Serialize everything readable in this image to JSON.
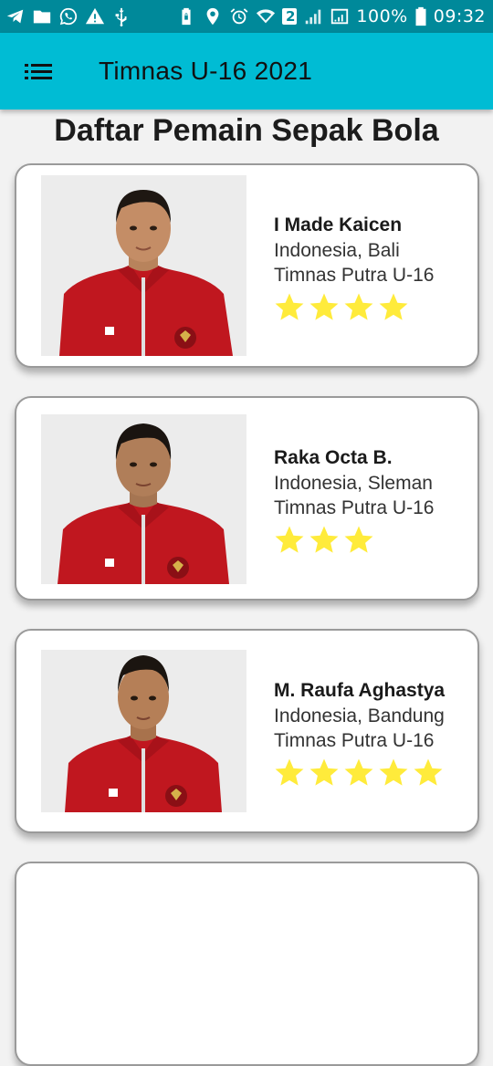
{
  "status_bar": {
    "battery": "100%",
    "time": "09:32",
    "sim_badge": "2",
    "left_icons": [
      "telegram-icon",
      "folder-icon",
      "whatsapp-icon",
      "warning-icon",
      "usb-icon"
    ],
    "right_icons": [
      "lock-battery-icon",
      "location-icon",
      "alarm-icon",
      "wifi-icon",
      "signal-icon",
      "signal-box-icon",
      "battery-icon"
    ]
  },
  "app_bar": {
    "title": "Timnas U-16 2021",
    "background": "#00bcd4",
    "menu_icon": "menu-icon"
  },
  "page": {
    "heading": "Daftar Pemain Sepak Bola"
  },
  "players": [
    {
      "name": "I Made Kaicen",
      "origin": "Indonesia, Bali",
      "team": "Timnas Putra U-16",
      "stars": 4
    },
    {
      "name": "Raka Octa B.",
      "origin": "Indonesia, Sleman",
      "team": "Timnas Putra U-16",
      "stars": 3
    },
    {
      "name": "M. Raufa Aghastya",
      "origin": "Indonesia, Bandung",
      "team": "Timnas Putra U-16",
      "stars": 5
    }
  ],
  "colors": {
    "status_bar": "#00899a",
    "star": "#ffeb3b",
    "jacket": "#c0171f"
  }
}
